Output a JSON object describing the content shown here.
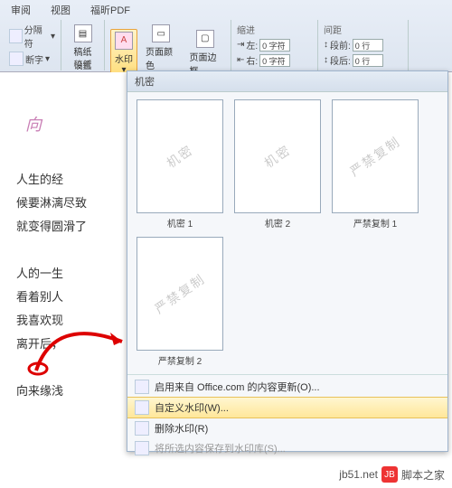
{
  "tabs": [
    "审阅",
    "视图",
    "福昕PDF"
  ],
  "ribbon": {
    "group1": {
      "item1": "分隔符",
      "item2": "断字",
      "btn": "稿纸\n设置",
      "label": "稿纸"
    },
    "group2": {
      "watermark": "水印",
      "pagecolor": "页面颜色",
      "pageborder": "页面边框"
    },
    "indent": {
      "title": "缩进",
      "left_label": "左:",
      "left_val": "0 字符",
      "right_label": "右:",
      "right_val": "0 字符"
    },
    "spacing": {
      "title": "间距",
      "before_label": "段前:",
      "before_val": "0 行",
      "after_label": "段后:",
      "after_val": "0 行"
    }
  },
  "gallery": {
    "header": "机密",
    "thumbs": [
      {
        "wm": "机密",
        "label": "机密 1"
      },
      {
        "wm": "机密",
        "label": "机密 2"
      },
      {
        "wm": "严禁复制",
        "label": "严禁复制 1"
      },
      {
        "wm": "严禁复制",
        "label": "严禁复制 2"
      }
    ],
    "menu": {
      "office": "启用来自 Office.com 的内容更新(O)...",
      "custom": "自定义水印(W)...",
      "remove": "删除水印(R)",
      "save": "将所选内容保存到水印库(S)..."
    }
  },
  "doc": {
    "title": "向",
    "lines": [
      "人生的经",
      "候要淋漓尽致",
      "就变得圆滑了",
      "",
      "人的一生",
      "看着别人",
      "我喜欢现",
      "离开后，",
      "",
      "向来缘浅"
    ]
  },
  "footer": {
    "site": "jb51.net",
    "brand": "脚本之家"
  }
}
